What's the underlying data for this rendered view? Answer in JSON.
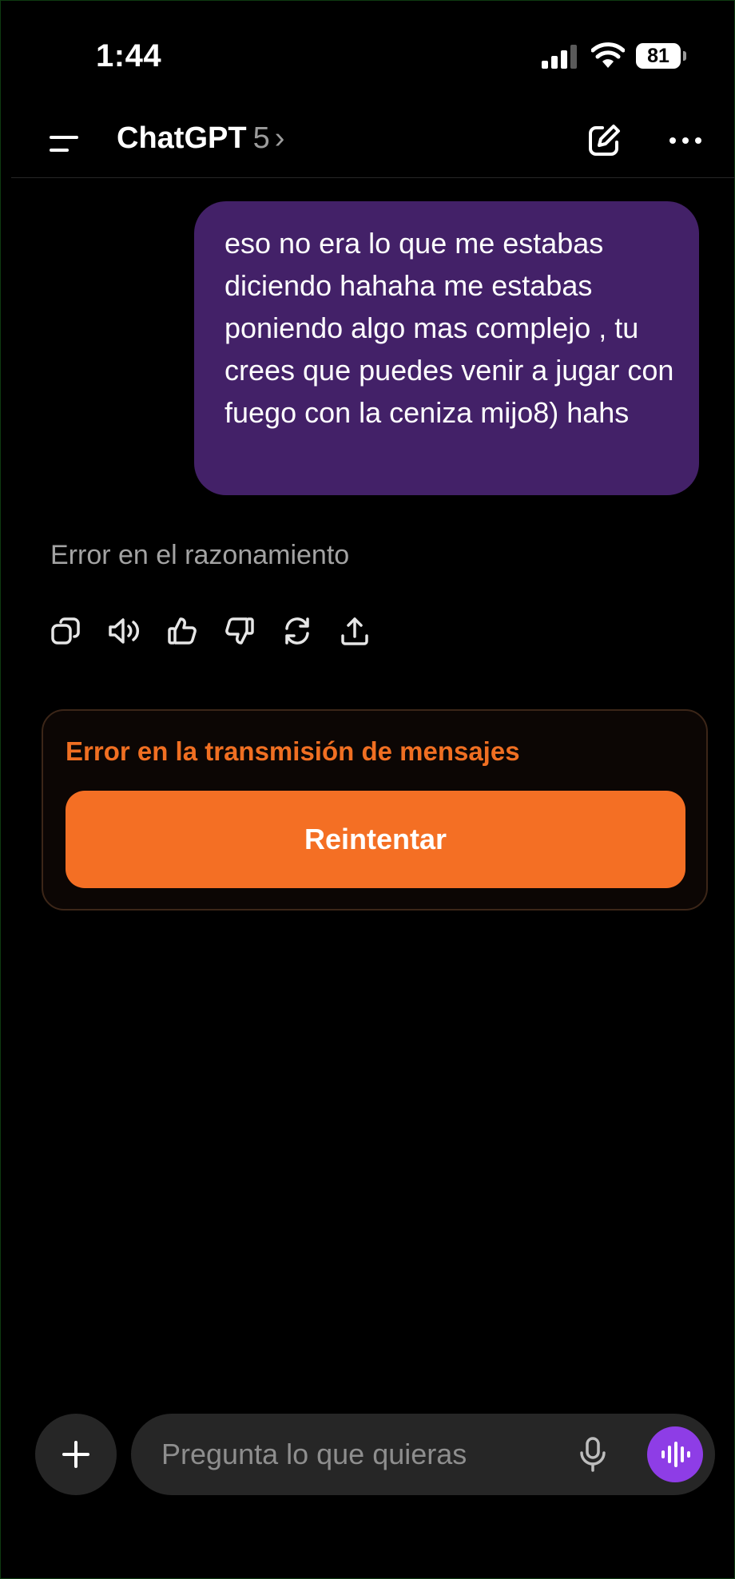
{
  "status_bar": {
    "time": "1:44",
    "battery_level": "81"
  },
  "header": {
    "title": "ChatGPT",
    "model_version": "5",
    "chevron": "›",
    "icons": [
      "menu-icon",
      "edit-icon",
      "more-icon"
    ]
  },
  "conversation": {
    "user_message": "eso no era lo que me estabas diciendo hahaha me estabas poniendo algo mas complejo , tu crees que puedes venir a jugar con fuego con la ceniza mijo8) hahs",
    "assistant_status": "Error en el razonamiento",
    "message_actions": [
      "copy-icon",
      "read-aloud-icon",
      "thumbs-up-icon",
      "thumbs-down-icon",
      "regenerate-icon",
      "share-icon"
    ]
  },
  "error_card": {
    "title": "Error en la transmisión de mensajes",
    "retry_label": "Reintentar"
  },
  "composer": {
    "placeholder": "Pregunta lo que quieras",
    "icons": [
      "plus-icon",
      "mic-icon",
      "voice-mode-icon"
    ]
  },
  "colors": {
    "background": "#000000",
    "user_bubble": "#432168",
    "error_accent": "#f06f22",
    "retry_button": "#f46f24",
    "voice_button": "#8e3de6",
    "composer_bg": "#262626"
  }
}
